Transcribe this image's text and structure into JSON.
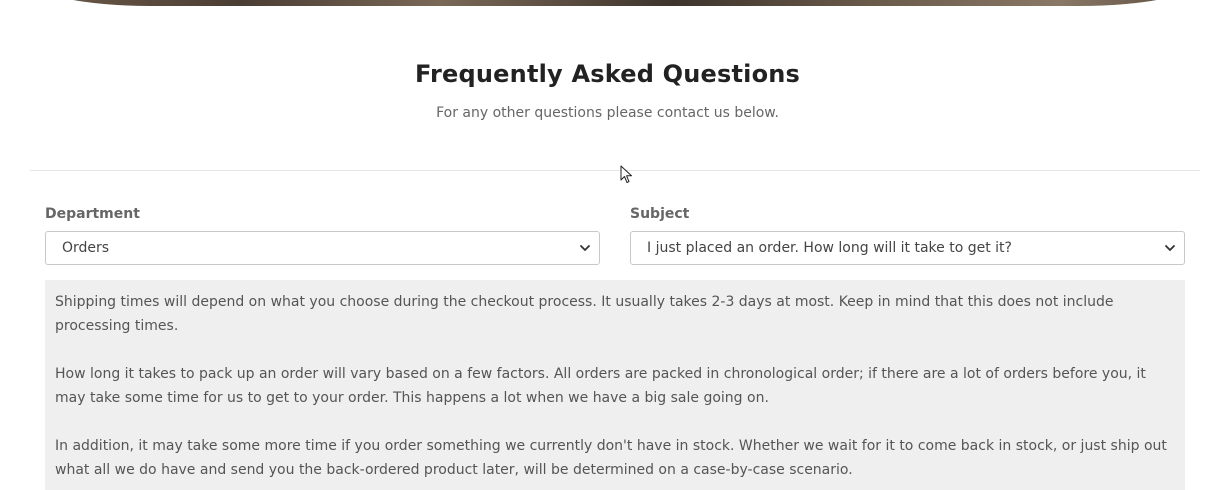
{
  "faq": {
    "title": "Frequently Asked Questions",
    "subtitle": "For any other questions please contact us below."
  },
  "department": {
    "label": "Department",
    "selected": "Orders"
  },
  "subject": {
    "label": "Subject",
    "selected": "I just placed an order. How long will it take to get it?"
  },
  "answer": {
    "paragraphs": [
      "Shipping times will depend on what you choose during the checkout process. It usually takes 2-3 days at most. Keep in mind that this does not include processing times.",
      "How long it takes to pack up an order will vary based on a few factors. All orders are packed in chronological order; if there are a lot of orders before you, it may take some time for us to get to your order. This happens a lot when we have a big sale going on.",
      "In addition, it may take some more time if you order something we currently don't have in stock. Whether we wait for it to come back in stock, or just ship out what all we do have and send you the back-ordered product later, will be determined on a case-by-case scenario."
    ]
  },
  "icons": {
    "chevron": "chevron-down-icon",
    "cursor": "mouse-pointer-icon"
  }
}
